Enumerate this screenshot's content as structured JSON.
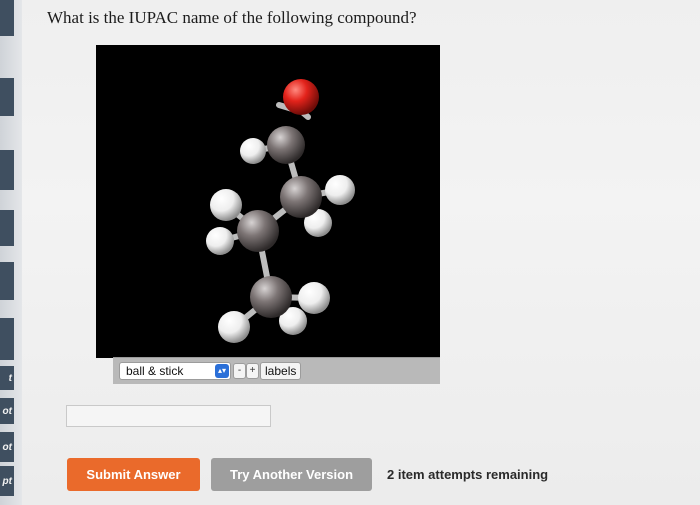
{
  "question": {
    "text": "What is the IUPAC name of the following compound?"
  },
  "sidebar": {
    "tabs": [
      "t",
      "ot",
      "ot",
      "pt"
    ]
  },
  "viewer": {
    "background": "#000000",
    "atom_colors": {
      "carbon": "#7d7575",
      "hydrogen": "#eeeeee",
      "oxygen": "#e3231b"
    },
    "controls": {
      "render_mode": "ball & stick",
      "zoom_out_label": "-",
      "zoom_in_label": "+",
      "labels_label": "labels"
    }
  },
  "answer": {
    "value": "",
    "placeholder": ""
  },
  "actions": {
    "submit_label": "Submit Answer",
    "try_another_label": "Try Another Version",
    "attempts_text": "2 item attempts remaining"
  }
}
